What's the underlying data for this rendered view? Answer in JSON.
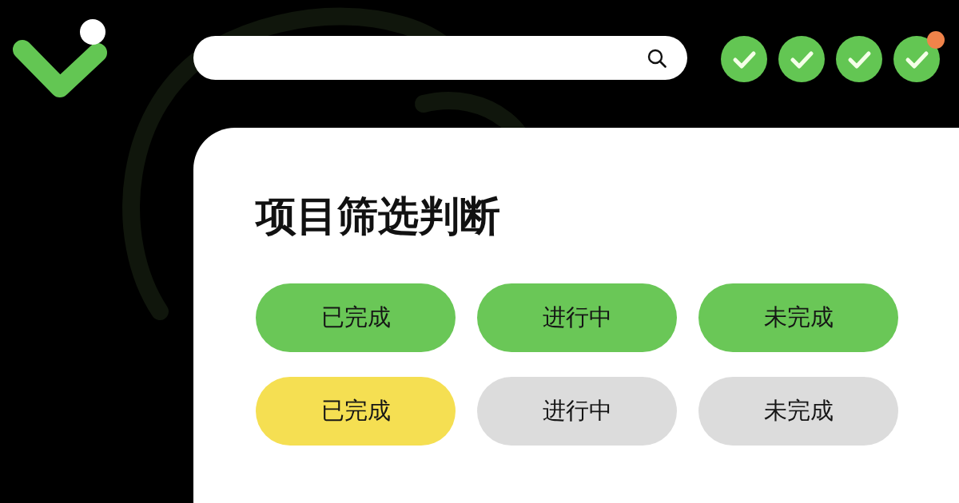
{
  "status_icons": [
    {
      "checked": true,
      "badge": false
    },
    {
      "checked": true,
      "badge": false
    },
    {
      "checked": true,
      "badge": false
    },
    {
      "checked": true,
      "badge": true
    }
  ],
  "card": {
    "title": "项目筛选判断",
    "rows": [
      {
        "buttons": [
          {
            "label": "已完成",
            "color": "#6ac757"
          },
          {
            "label": "进行中",
            "color": "#6ac757"
          },
          {
            "label": "未完成",
            "color": "#6ac757"
          }
        ]
      },
      {
        "buttons": [
          {
            "label": "已完成",
            "color": "#f5df52"
          },
          {
            "label": "进行中",
            "color": "#dcdcdc"
          },
          {
            "label": "未完成",
            "color": "#dcdcdc"
          }
        ]
      }
    ]
  }
}
